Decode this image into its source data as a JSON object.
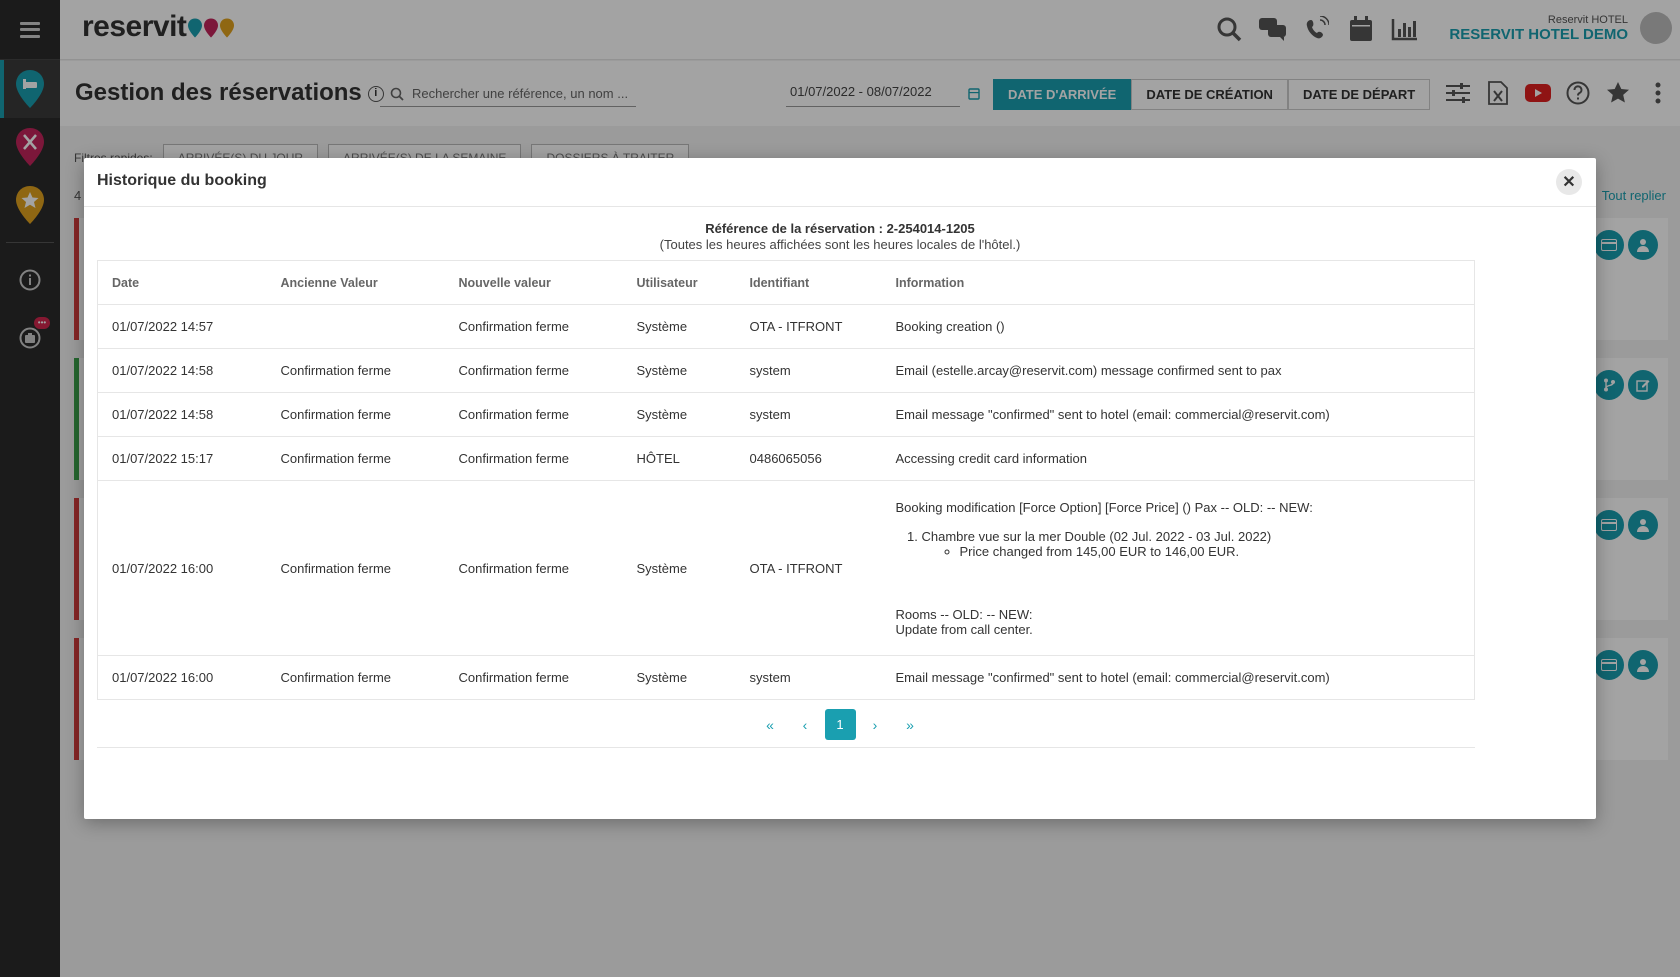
{
  "app": {
    "logo": "reservit",
    "hotel_small": "Reservit HOTEL",
    "hotel_name": "RESERVIT HOTEL DEMO"
  },
  "sidebar": {
    "items": [
      {
        "icon": "bed-pin-icon",
        "color": "#1a9fb0"
      },
      {
        "icon": "restaurant-pin-icon",
        "color": "#c2255c"
      },
      {
        "icon": "star-pin-icon",
        "color": "#e0a21e"
      },
      {
        "icon": "info-icon"
      },
      {
        "icon": "briefcase-icon",
        "badge": "•••"
      }
    ]
  },
  "header": {
    "page_title": "Gestion des réservations",
    "search_placeholder": "Rechercher une référence, un nom ...",
    "date_range": "01/07/2022 - 08/07/2022",
    "date_tabs": [
      "DATE D'ARRIVÉE",
      "DATE DE CRÉATION",
      "DATE DE DÉPART"
    ],
    "active_tab": 0
  },
  "background": {
    "filters_label": "Filtres rapides:",
    "filters": [
      "ARRIVÉE(S) DU JOUR",
      "ARRIVÉE(S) DE LA SEMAINE",
      "DOSSIERS À TRAITER"
    ],
    "count": "4",
    "collapse_all": "Tout replier"
  },
  "modal": {
    "title": "Historique du booking",
    "close_label": "✕",
    "reference": "Référence de la réservation : 2-254014-1205",
    "timezone_note": "(Toutes les heures affichées sont les heures locales de l'hôtel.)",
    "columns": [
      "Date",
      "Ancienne Valeur",
      "Nouvelle valeur",
      "Utilisateur",
      "Identifiant",
      "Information"
    ],
    "rows": [
      {
        "date": "01/07/2022 14:57",
        "old": "",
        "new": "Confirmation ferme",
        "user": "Système",
        "id": "OTA - ITFRONT",
        "info": "Booking creation ()"
      },
      {
        "date": "01/07/2022 14:58",
        "old": "Confirmation ferme",
        "new": "Confirmation ferme",
        "user": "Système",
        "id": "system",
        "info": "Email (estelle.arcay@reservit.com) message confirmed sent to pax"
      },
      {
        "date": "01/07/2022 14:58",
        "old": "Confirmation ferme",
        "new": "Confirmation ferme",
        "user": "Système",
        "id": "system",
        "info": "Email message \"confirmed\" sent to hotel (email: commercial@reservit.com)"
      },
      {
        "date": "01/07/2022 15:17",
        "old": "Confirmation ferme",
        "new": "Confirmation ferme",
        "user": "HÔTEL",
        "id": "0486065056",
        "info": "Accessing credit card information"
      },
      {
        "date": "01/07/2022 16:00",
        "old": "Confirmation ferme",
        "new": "Confirmation ferme",
        "user": "Système",
        "id": "OTA - ITFRONT",
        "info_detail": {
          "line1": "Booking modification [Force Option] [Force Price] () Pax -- OLD: -- NEW:",
          "room": "Chambre vue sur la mer Double (02 Jul. 2022 - 03 Jul. 2022)",
          "price_change": "Price changed from 145,00 EUR to 146,00 EUR.",
          "rooms_line": "Rooms -- OLD: -- NEW:",
          "update_line": "Update from call center."
        }
      },
      {
        "date": "01/07/2022 16:00",
        "old": "Confirmation ferme",
        "new": "Confirmation ferme",
        "user": "Système",
        "id": "system",
        "info": "Email message \"confirmed\" sent to hotel (email: commercial@reservit.com)"
      }
    ],
    "pagination": {
      "first": "«",
      "prev": "‹",
      "current": "1",
      "next": "›",
      "last": "»"
    }
  },
  "colors": {
    "accent": "#1a9fb0",
    "restaurant": "#c2255c",
    "star": "#e0a21e",
    "danger": "#d03a3a",
    "success": "#3aa04a"
  }
}
